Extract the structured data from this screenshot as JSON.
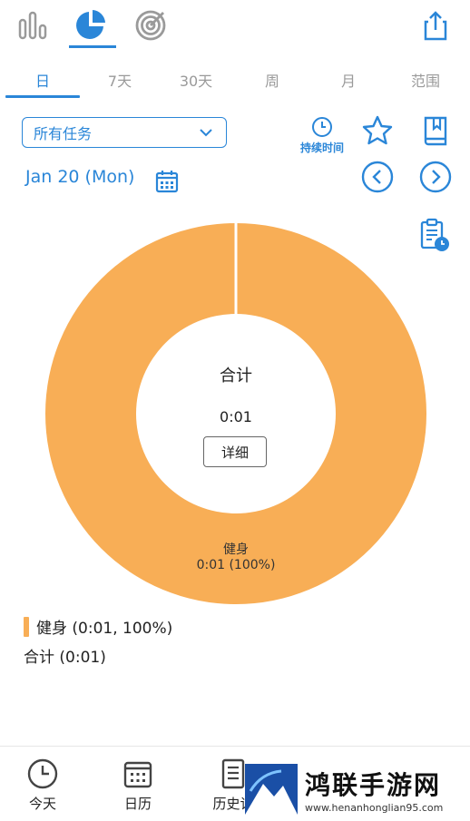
{
  "toolbar": {
    "icons": [
      "bar-chart-icon",
      "pie-chart-icon",
      "target-icon",
      "share-icon"
    ],
    "active_index": 1
  },
  "tabs": [
    {
      "label": "日",
      "active": true
    },
    {
      "label": "7天",
      "active": false
    },
    {
      "label": "30天",
      "active": false
    },
    {
      "label": "周",
      "active": false
    },
    {
      "label": "月",
      "active": false
    },
    {
      "label": "范围",
      "active": false
    }
  ],
  "filter": {
    "selected": "所有任务"
  },
  "duration_label": "持续时间",
  "date": {
    "label": "Jan 20 (Mon)"
  },
  "chart_data": {
    "type": "pie",
    "center_title": "合计",
    "center_value": "0:01",
    "center_button": "详细",
    "slices": [
      {
        "name": "健身",
        "value": 100,
        "label_name": "健身",
        "label_value": "0:01 (100%)",
        "color": "#f8ae56"
      }
    ]
  },
  "legend": {
    "items": [
      {
        "label": "健身 (0:01, 100%)",
        "color": "#f8ae56"
      }
    ],
    "total": "合计 (0:01)"
  },
  "bottom_nav": [
    {
      "icon": "clock-icon",
      "label": "今天"
    },
    {
      "icon": "calendar-icon",
      "label": "日历"
    },
    {
      "icon": "document-icon",
      "label": "历史记"
    }
  ],
  "watermark": {
    "brand": "鸿联手游网",
    "url": "www.henanhonglian95.com"
  },
  "colors": {
    "accent": "#2a86d8",
    "slice": "#f8ae56",
    "inactive": "#9a9a9a"
  }
}
